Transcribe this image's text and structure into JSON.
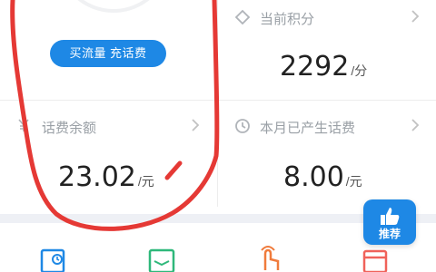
{
  "top_left": {
    "button_label": "买流量 充话费"
  },
  "points": {
    "label": "当前积分",
    "value": "2292",
    "unit": "/分"
  },
  "balance": {
    "label": "话费余额",
    "value": "23.02",
    "unit": "/元"
  },
  "monthly": {
    "label": "本月已产生话费",
    "value": "8.00",
    "unit": "/元"
  },
  "badge": {
    "label": "推荐"
  },
  "colors": {
    "accent": "#1e88e5",
    "annotation": "#e53935",
    "gap": "#eef0f5"
  },
  "icons": [
    "diamond-icon",
    "clock-icon",
    "yen-icon",
    "chevron-right-icon",
    "thumbs-up-icon",
    "bill-icon",
    "card-icon",
    "tap-icon",
    "wallet-icon"
  ]
}
